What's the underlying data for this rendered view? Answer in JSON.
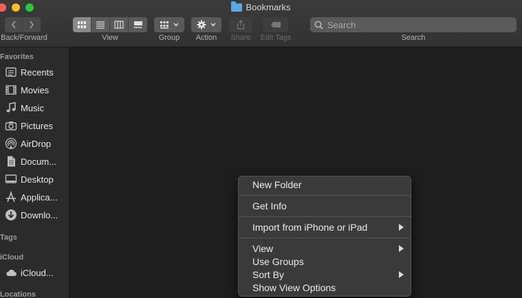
{
  "window": {
    "title": "Bookmarks"
  },
  "toolbar": {
    "back_forward_label": "Back/Forward",
    "view_label": "View",
    "group_label": "Group",
    "action_label": "Action",
    "share_label": "Share",
    "edit_tags_label": "Edit Tags",
    "search_label": "Search",
    "search_placeholder": "Search"
  },
  "sidebar": {
    "favorites_header": "Favorites",
    "items": [
      {
        "label": "Recents",
        "icon": "clock-icon"
      },
      {
        "label": "Movies",
        "icon": "film-icon"
      },
      {
        "label": "Music",
        "icon": "music-note-icon"
      },
      {
        "label": "Pictures",
        "icon": "camera-icon"
      },
      {
        "label": "AirDrop",
        "icon": "airdrop-icon"
      },
      {
        "label": "Docum...",
        "icon": "document-icon"
      },
      {
        "label": "Desktop",
        "icon": "desktop-icon"
      },
      {
        "label": "Applica...",
        "icon": "applications-icon"
      },
      {
        "label": "Downlo...",
        "icon": "download-icon"
      }
    ],
    "tags_header": "Tags",
    "icloud_header": "iCloud",
    "icloud_item": {
      "label": "iCloud...",
      "icon": "cloud-icon"
    },
    "locations_header": "Locations"
  },
  "context_menu": {
    "new_folder": "New Folder",
    "get_info": "Get Info",
    "import": "Import from iPhone or iPad",
    "view": "View",
    "use_groups": "Use Groups",
    "sort_by": "Sort By",
    "show_view_options": "Show View Options"
  }
}
